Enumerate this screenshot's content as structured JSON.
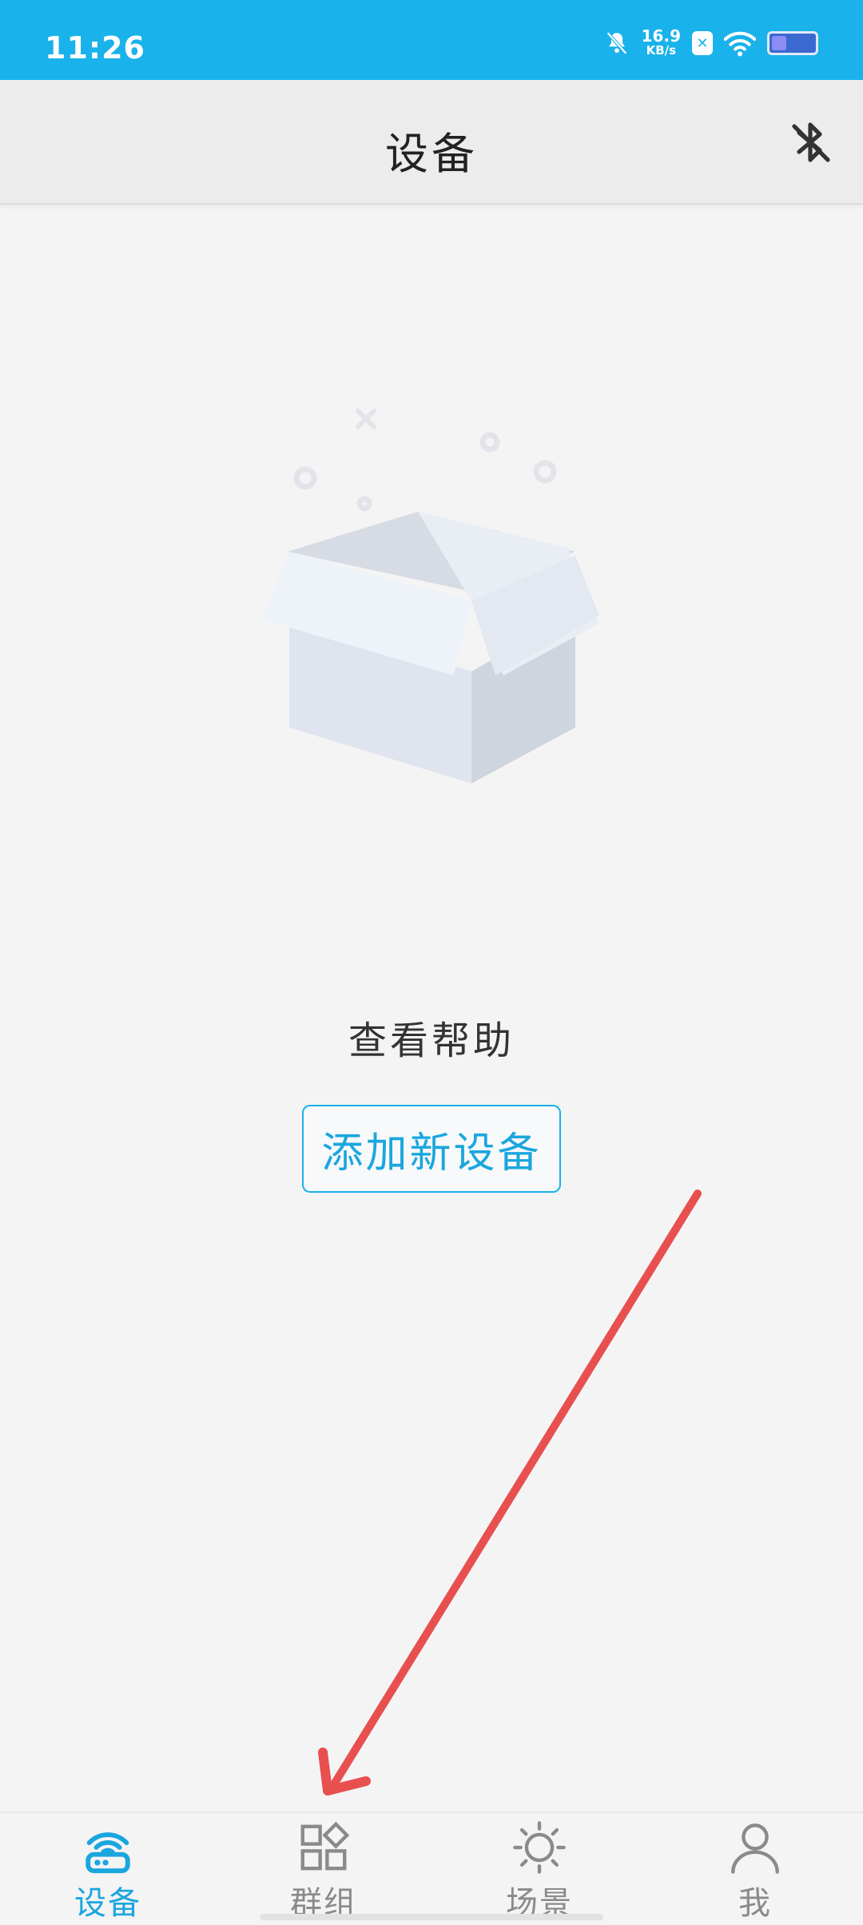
{
  "status_bar": {
    "time": "11:26",
    "net_speed_value": "16.9",
    "net_speed_unit": "KB/s",
    "icons": [
      "bell-muted-icon",
      "app-badge-icon",
      "wifi-icon",
      "battery-icon"
    ],
    "battery_level": 0.35
  },
  "header": {
    "title": "设备",
    "right_icon": "bluetooth-off-icon"
  },
  "empty_state": {
    "illustration": "open-box-icon",
    "help_text": "查看帮助",
    "add_button_label": "添加新设备"
  },
  "bottom_nav": {
    "items": [
      {
        "label": "设备",
        "icon": "router-icon",
        "active": true
      },
      {
        "label": "群组",
        "icon": "groups-icon",
        "active": false
      },
      {
        "label": "场景",
        "icon": "sun-icon",
        "active": false
      },
      {
        "label": "我",
        "icon": "person-icon",
        "active": false
      }
    ]
  },
  "colors": {
    "accent": "#1ab2ea",
    "annotation": "#e84f4f",
    "background": "#f4f4f5"
  }
}
